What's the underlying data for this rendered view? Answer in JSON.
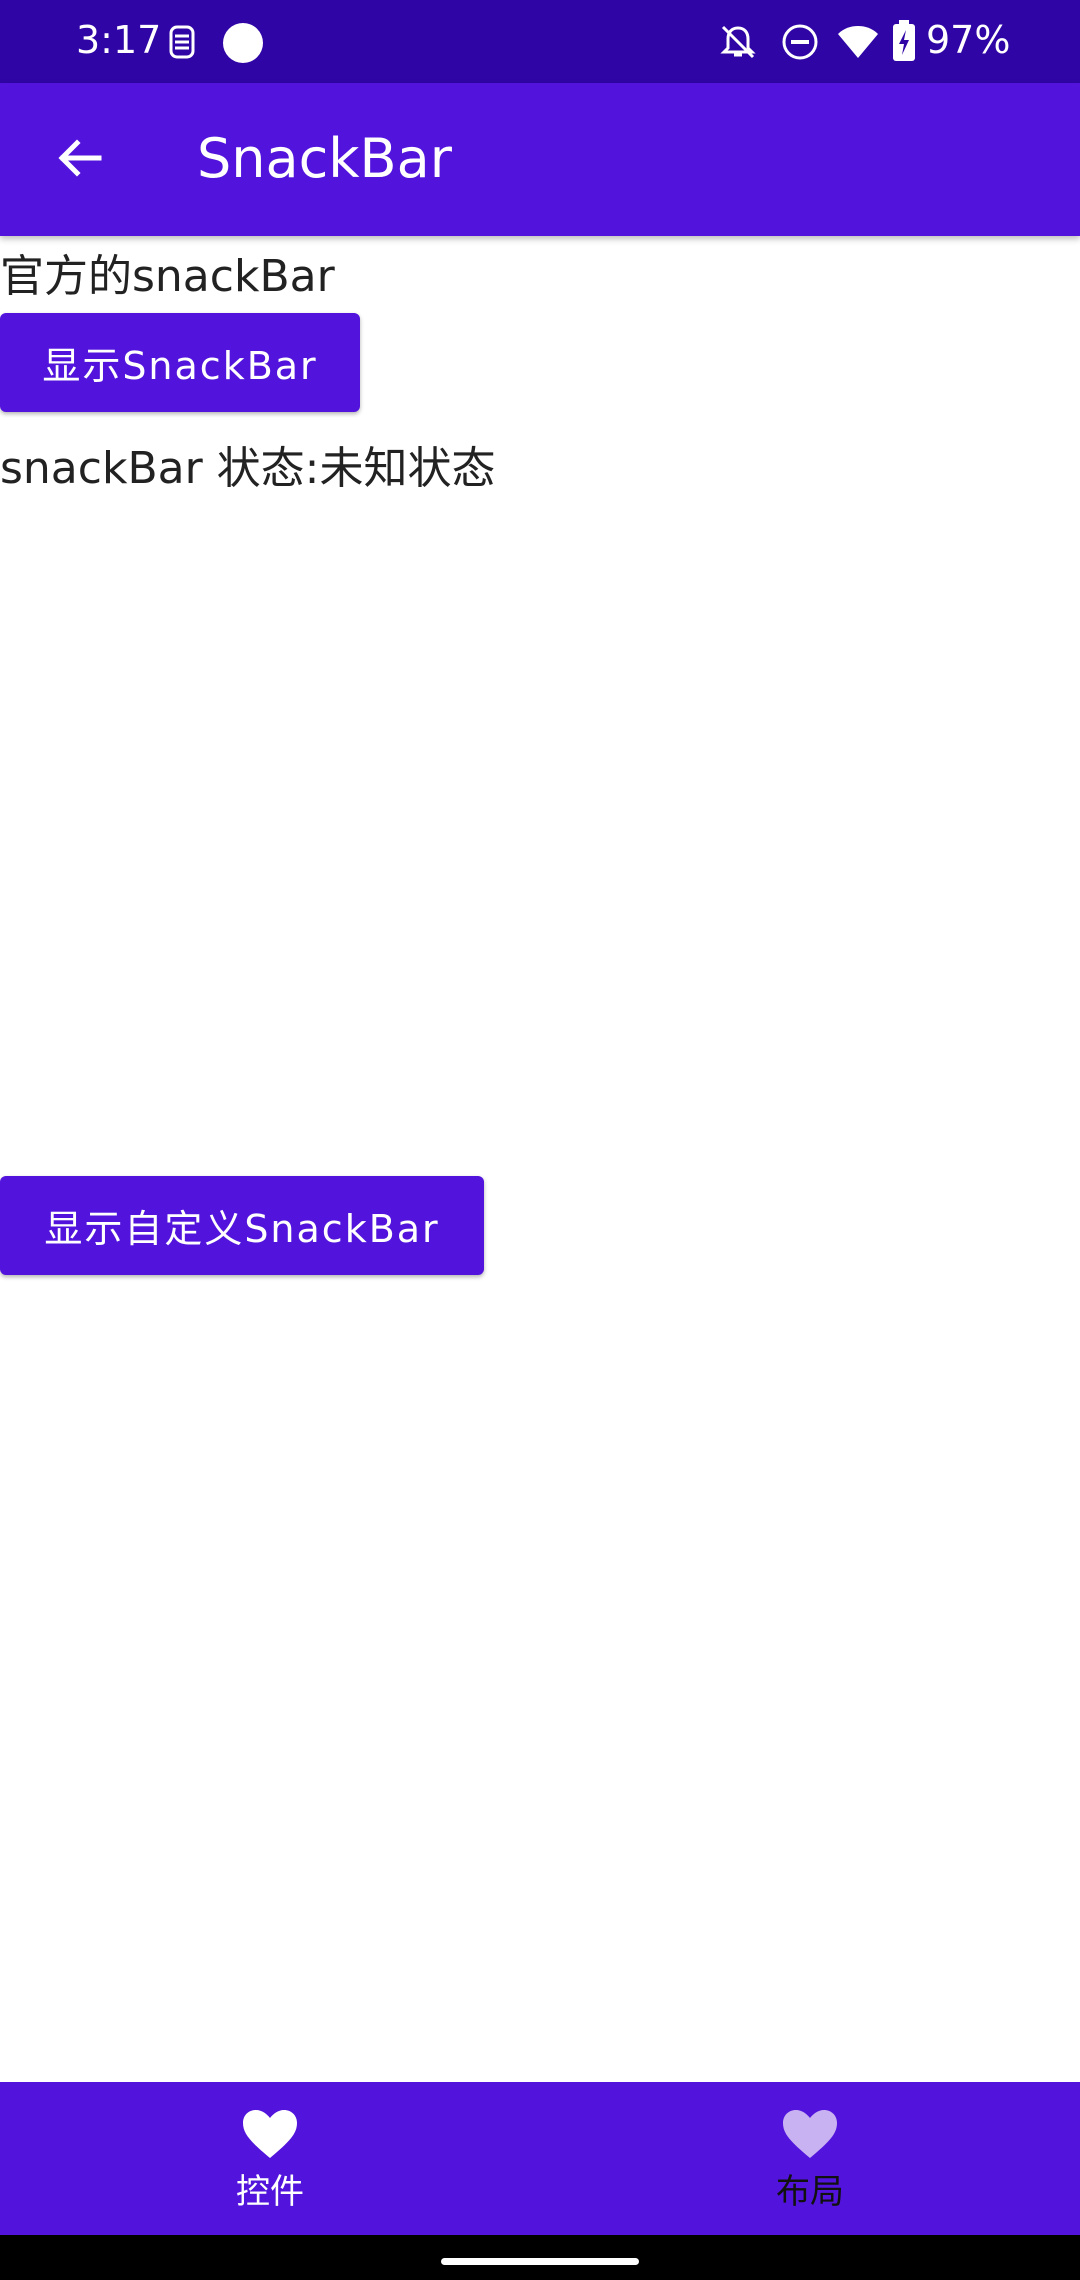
{
  "status_bar": {
    "time": "3:17",
    "battery": "97%"
  },
  "app_bar": {
    "title": "SnackBar"
  },
  "content": {
    "section_label": "官方的snackBar",
    "show_snackbar_button": "显示SnackBar",
    "snackbar_status": "snackBar 状态:未知状态",
    "show_custom_snackbar_button": "显示自定义SnackBar"
  },
  "bottom_nav": {
    "items": [
      {
        "label": "控件",
        "icon": "heart-icon",
        "selected": true
      },
      {
        "label": "布局",
        "icon": "heart-icon",
        "selected": false
      }
    ]
  },
  "colors": {
    "primary": "#5214dc",
    "status_bar": "#2f05a6",
    "nav_selected": "#ffffff",
    "nav_unselected": "#c9b2f2"
  }
}
